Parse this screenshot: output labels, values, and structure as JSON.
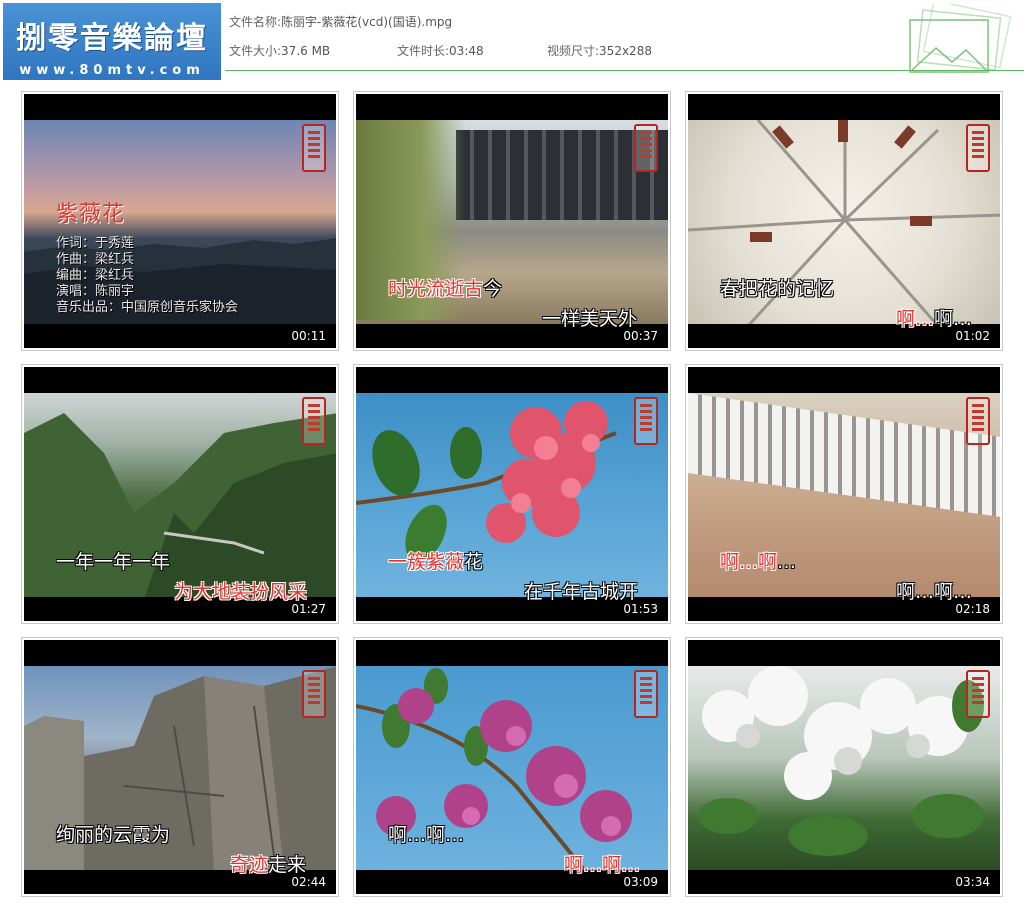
{
  "header": {
    "logo_title": "捌零音樂論壇",
    "logo_url": "www.80mtv.com",
    "file_name_label": "文件名称:",
    "file_name": "陈丽宇-紫薇花(vcd)(国语).mpg",
    "file_size_label": "文件大小:",
    "file_size": "37.6 MB",
    "duration_label": "文件时长:",
    "duration": "03:48",
    "video_size_label": "视频尺寸:",
    "video_size": "352x288"
  },
  "thumbnails": [
    {
      "time": "00:11",
      "song_title": "紫薇花",
      "credits": [
        "作词：于秀莲",
        "作曲：梁红兵",
        "编曲：梁红兵",
        "演唱：陈丽宇",
        "音乐出品：中国原创音乐家协会"
      ]
    },
    {
      "time": "00:37",
      "captions": [
        {
          "text": "时光流逝古",
          "color": "red"
        },
        {
          "text": "今",
          "color": "white"
        },
        {
          "text": "一样美天外",
          "color": "white"
        }
      ]
    },
    {
      "time": "01:02",
      "captions": [
        {
          "text": "春把花的记忆",
          "color": "white"
        },
        {
          "text": "啊…",
          "color": "red"
        },
        {
          "text": "啊…",
          "color": "white"
        }
      ]
    },
    {
      "time": "01:27",
      "captions": [
        {
          "text": "一年一年一年",
          "color": "white"
        },
        {
          "text": "为大地装扮风采",
          "color": "red"
        }
      ]
    },
    {
      "time": "01:53",
      "captions": [
        {
          "text": "一簇紫薇",
          "color": "red"
        },
        {
          "text": "花",
          "color": "white"
        },
        {
          "text": "在千年古城开",
          "color": "white"
        }
      ]
    },
    {
      "time": "02:18",
      "captions": [
        {
          "text": "啊…啊",
          "color": "red"
        },
        {
          "text": "…",
          "color": "white"
        },
        {
          "text": "啊…啊…",
          "color": "white"
        }
      ]
    },
    {
      "time": "02:44",
      "captions": [
        {
          "text": "绚丽的云霞为",
          "color": "white"
        },
        {
          "text": "奇迹",
          "color": "red"
        },
        {
          "text": "走来",
          "color": "white"
        }
      ]
    },
    {
      "time": "03:09",
      "captions": [
        {
          "text": "啊…啊…",
          "color": "white"
        },
        {
          "text": "啊…啊…",
          "color": "red"
        }
      ]
    },
    {
      "time": "03:34",
      "captions": []
    }
  ]
}
